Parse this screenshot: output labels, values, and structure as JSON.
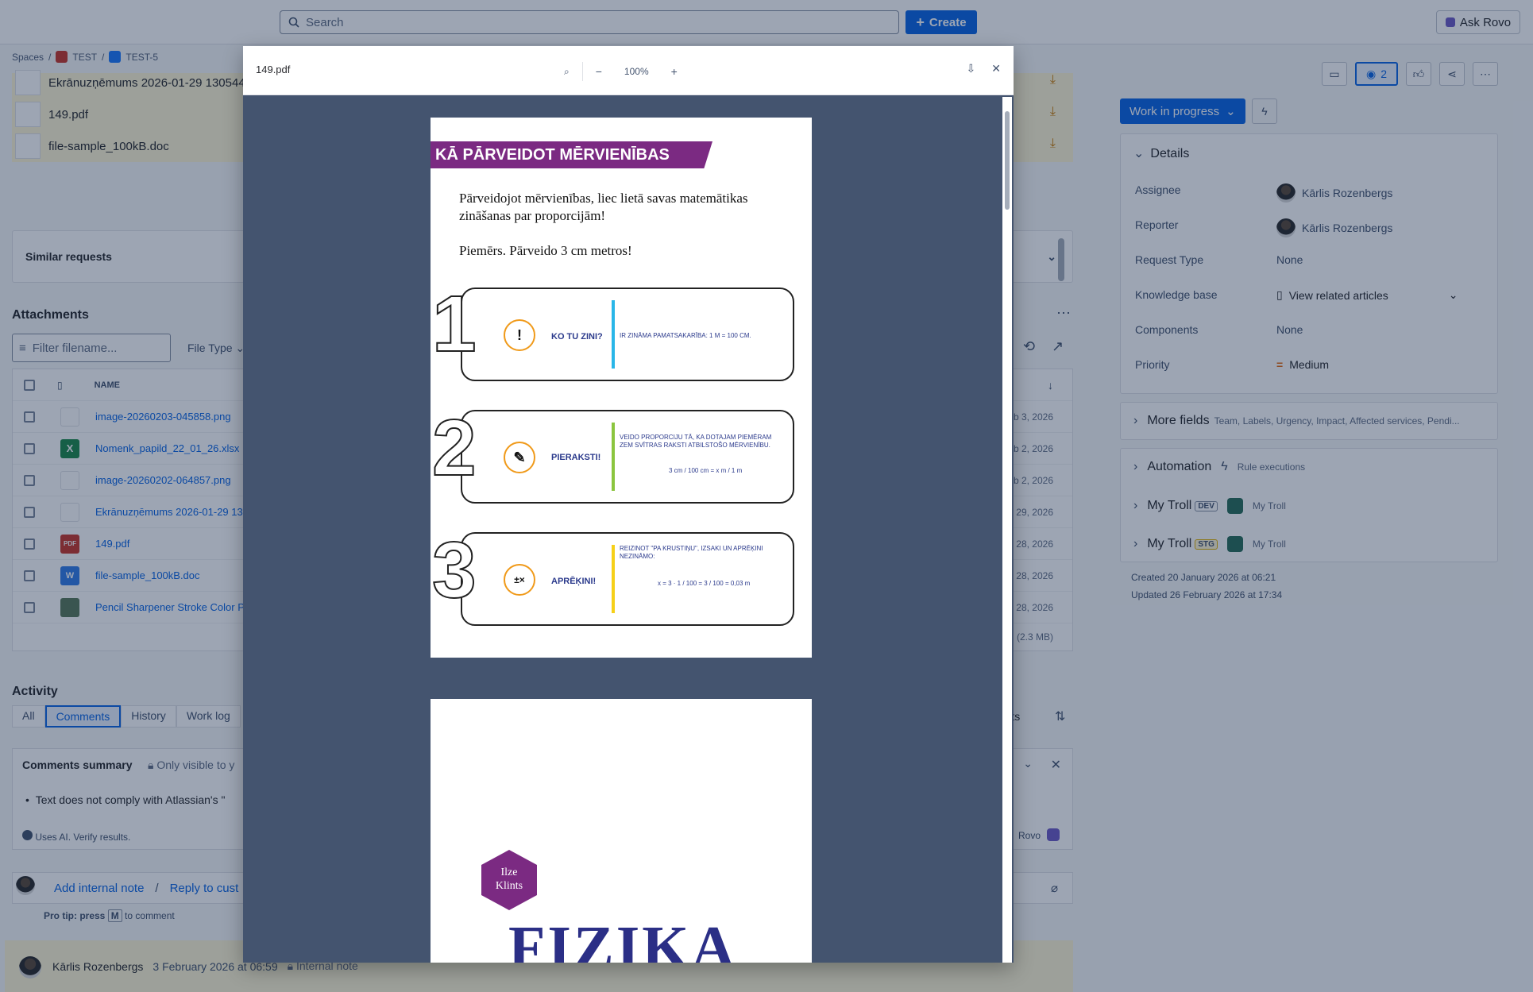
{
  "topnav": {
    "search_placeholder": "Search",
    "create": "Create",
    "ask_rovo": "Ask Rovo"
  },
  "breadcrumb": [
    "Spaces",
    "/",
    "TEST",
    "/",
    "TEST-5"
  ],
  "strip_files": [
    "Ekrānuzņēmums 2026-01-29 130544",
    "149.pdf",
    "file-sample_100kB.doc"
  ],
  "similar_label": "Similar requests",
  "attachments": {
    "title": "Attachments",
    "filter_placeholder": "Filter filename...",
    "file_type": "File Type",
    "col_name": "NAME",
    "rows": [
      {
        "name": "image-20260203-045858.png",
        "date": "b 3, 2026",
        "icon": "image-icon"
      },
      {
        "name": "Nomenk_papild_22_01_26.xlsx",
        "date": "b 2, 2026",
        "icon": "excel-icon"
      },
      {
        "name": "image-20260202-064857.png",
        "date": "b 2, 2026",
        "icon": "image-icon"
      },
      {
        "name": "Ekrānuzņēmums 2026-01-29 13",
        "date": "29, 2026",
        "icon": "image-icon"
      },
      {
        "name": "149.pdf",
        "date": "28, 2026",
        "icon": "pdf-icon"
      },
      {
        "name": "file-sample_100kB.doc",
        "date": "28, 2026",
        "icon": "word-icon"
      },
      {
        "name": "Pencil Sharpener Stroke Color Pl",
        "date": "28, 2026",
        "icon": "image-icon"
      }
    ],
    "total": "(2.3 MB)"
  },
  "activity": {
    "title": "Activity",
    "tabs": [
      "All",
      "Comments",
      "History",
      "Work log"
    ],
    "comments_summary": "Comments summary",
    "only_visible": "Only visible to y",
    "bullet": "Text does not comply with Atlassian's \"",
    "uses_ai": "Uses AI. Verify results.",
    "rovo": "Rovo",
    "comments_tail": "nents",
    "add_internal": "Add internal note",
    "reply": "Reply to cust",
    "protip_pre": "Pro tip: press",
    "protip_key": "M",
    "protip_post": "to comment",
    "comment_author": "Kārlis Rozenbergs",
    "comment_date": "3 February 2026 at 06:59",
    "comment_type": "Internal note"
  },
  "right": {
    "watch_count": "2",
    "status": "Work in progress",
    "details_title": "Details",
    "fields": [
      {
        "label": "Assignee",
        "value": "Kārlis Rozenbergs"
      },
      {
        "label": "Reporter",
        "value": "Kārlis Rozenbergs"
      },
      {
        "label": "Request Type",
        "value": "None"
      },
      {
        "label": "Knowledge base",
        "value": "View related articles"
      },
      {
        "label": "Components",
        "value": "None"
      },
      {
        "label": "Priority",
        "value": "Medium"
      }
    ],
    "more_fields": "More fields",
    "more_fields_sub": "Team, Labels, Urgency, Impact, Affected services, Pendi...",
    "automation": "Automation",
    "rule_exec": "Rule executions",
    "troll_dev": "My Troll",
    "dev_tag": "DEV",
    "troll_dev_sub": "My Troll",
    "troll_stg": "My Troll",
    "stg_tag": "STG",
    "troll_stg_sub": "My Troll",
    "created": "Created 20 January 2026 at 06:21",
    "updated": "Updated 26 February 2026 at 17:34"
  },
  "viewer": {
    "filename": "149.pdf",
    "zoom": "100%",
    "page1": {
      "title": "KĀ PĀRVEIDOT MĒRVIENĪBAS",
      "intro1": "Pārveidojot mērvienības, liec lietā savas matemātikas",
      "intro2": "zināšanas par proporcijām!",
      "example": "Piemērs. Pārveido 3 cm metros!",
      "step1_label": "KO TU ZINI?",
      "step1_body": "IR ZINĀMA PAMATSAKARĪBA: 1 M = 100 CM.",
      "step2_label": "PIERAKSTI!",
      "step2_body1": "VEIDO PROPORCIJU TĀ, KA DOTAJAM PIEMĒRAM",
      "step2_body2": "ZEM SVĪTRAS RAKSTI ATBILSTOŠO MĒRVIENĪBU.",
      "step2_formula": "3 cm / 100 cm = x m / 1 m",
      "step3_label": "APRĒĶINI!",
      "step3_body1": "REIZINOT \"PA KRUSTIŅU\", IZSAKI UN APRĒĶINI",
      "step3_body2": "NEZINĀMO:",
      "step3_formula": "x = 3 · 1 / 100 = 3 / 100 = 0,03 m"
    },
    "page2": {
      "author1": "Ilze",
      "author2": "Klints",
      "title": "FIZIKA"
    }
  }
}
